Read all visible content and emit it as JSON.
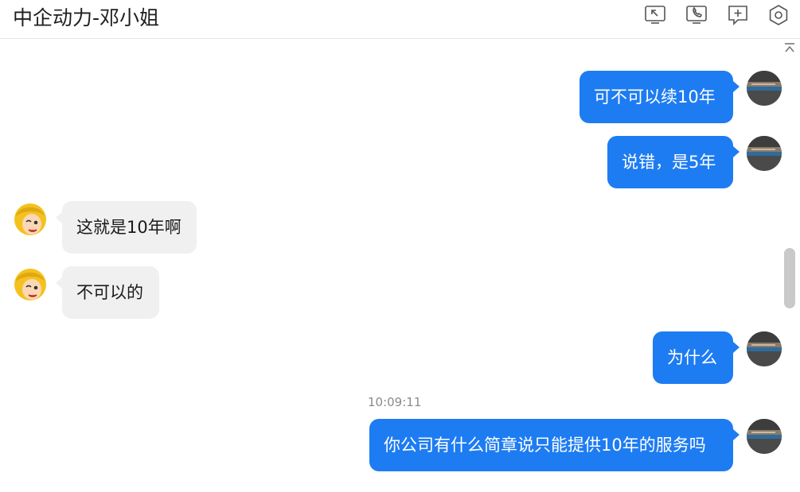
{
  "window": {
    "title": "中企动力-邓小姐"
  },
  "toolbar": {
    "icons": [
      "screen-share-icon",
      "phone-icon",
      "add-chat-icon",
      "settings-icon"
    ]
  },
  "messages": [
    {
      "direction": "out",
      "text": "可不可以续10年"
    },
    {
      "direction": "out",
      "text": "说错，是5年"
    },
    {
      "direction": "in",
      "text": "这就是10年啊"
    },
    {
      "direction": "in",
      "text": "不可以的"
    },
    {
      "direction": "out",
      "text": "为什么"
    },
    {
      "direction": "out",
      "text": "你公司有什么简章说只能提供10年的服务吗"
    }
  ],
  "timestamp": "10:09:11",
  "colors": {
    "outgoing_bubble": "#1e7cf2",
    "incoming_bubble": "#f0f0f0"
  }
}
